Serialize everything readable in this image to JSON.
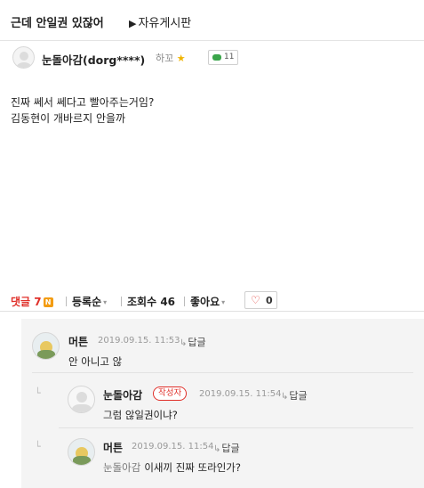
{
  "post": {
    "title": "근데 안일권 있잖어",
    "board_arrow": "▶",
    "board": "자유게시판",
    "author": "눈돌아감(dorg****)",
    "level": "하꼬",
    "star": "★",
    "message_count": "11",
    "body": [
      "진짜 쎄서 쎄다고 빨아주는거임?",
      "김동현이 개바르지 안을까"
    ]
  },
  "toolbar": {
    "comment_label": "댓글",
    "comment_count": "7",
    "new_badge": "N",
    "sort_label": "등록순",
    "caret": "▾",
    "views_label": "조회수",
    "views": "46",
    "like_label": "좋아요",
    "like_heart": "♡",
    "like_count": "0"
  },
  "comments": [
    {
      "author": "머튼",
      "time": "2019.09.15. 11:53",
      "reply_label": "답글",
      "text": "안 아니고 않"
    },
    {
      "author": "눈돌아감",
      "badge": "작성자",
      "time": "2019.09.15. 11:54",
      "reply_label": "답글",
      "text": "그럼 않일권이냐?"
    },
    {
      "author": "머튼",
      "time": "2019.09.15. 11:54",
      "reply_label": "답글",
      "mention": "눈돌아감",
      "text": "이새끼 진짜 또라인가?"
    }
  ],
  "icons": {
    "reply_arrow": "↳",
    "thread_line": "└"
  },
  "colors": {
    "accent_red": "#e0302a",
    "badge_orange": "#f39c12",
    "message_green": "#3aa54a",
    "comment_bg": "#f4f4f4"
  }
}
